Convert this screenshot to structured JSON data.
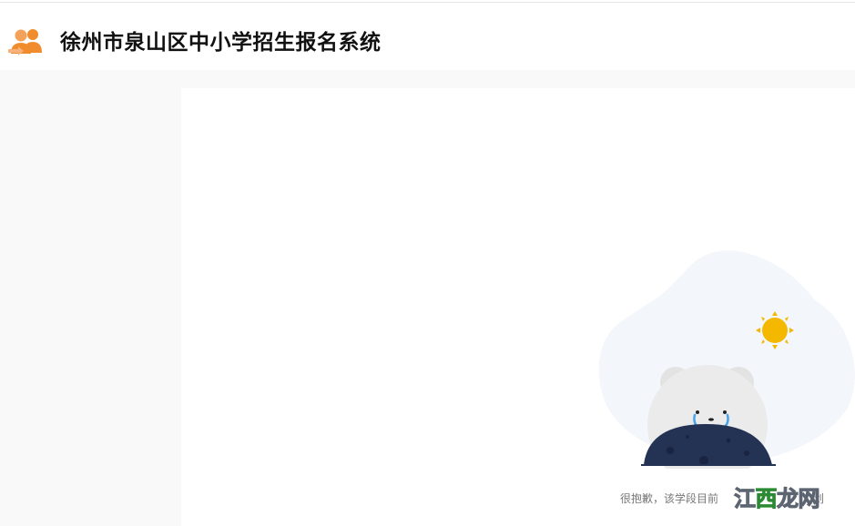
{
  "header": {
    "title": "徐州市泉山区中小学招生报名系统",
    "logo_icon": "users-group-icon"
  },
  "main": {
    "empty_state": {
      "illustration": "crying-bear-sun-illustration",
      "message": "很抱歉，该学段目前",
      "message_tail": "划"
    }
  },
  "watermark": {
    "text_part1": "江",
    "text_part2": "西",
    "text_part3": "龙网"
  },
  "colors": {
    "logo_orange": "#f08c2e",
    "sun_yellow": "#f5b800",
    "planet_navy": "#243253",
    "tear_blue": "#4aa3e8",
    "bear_gray": "#e8e8e8",
    "blob_bg": "#f3f6fa"
  }
}
